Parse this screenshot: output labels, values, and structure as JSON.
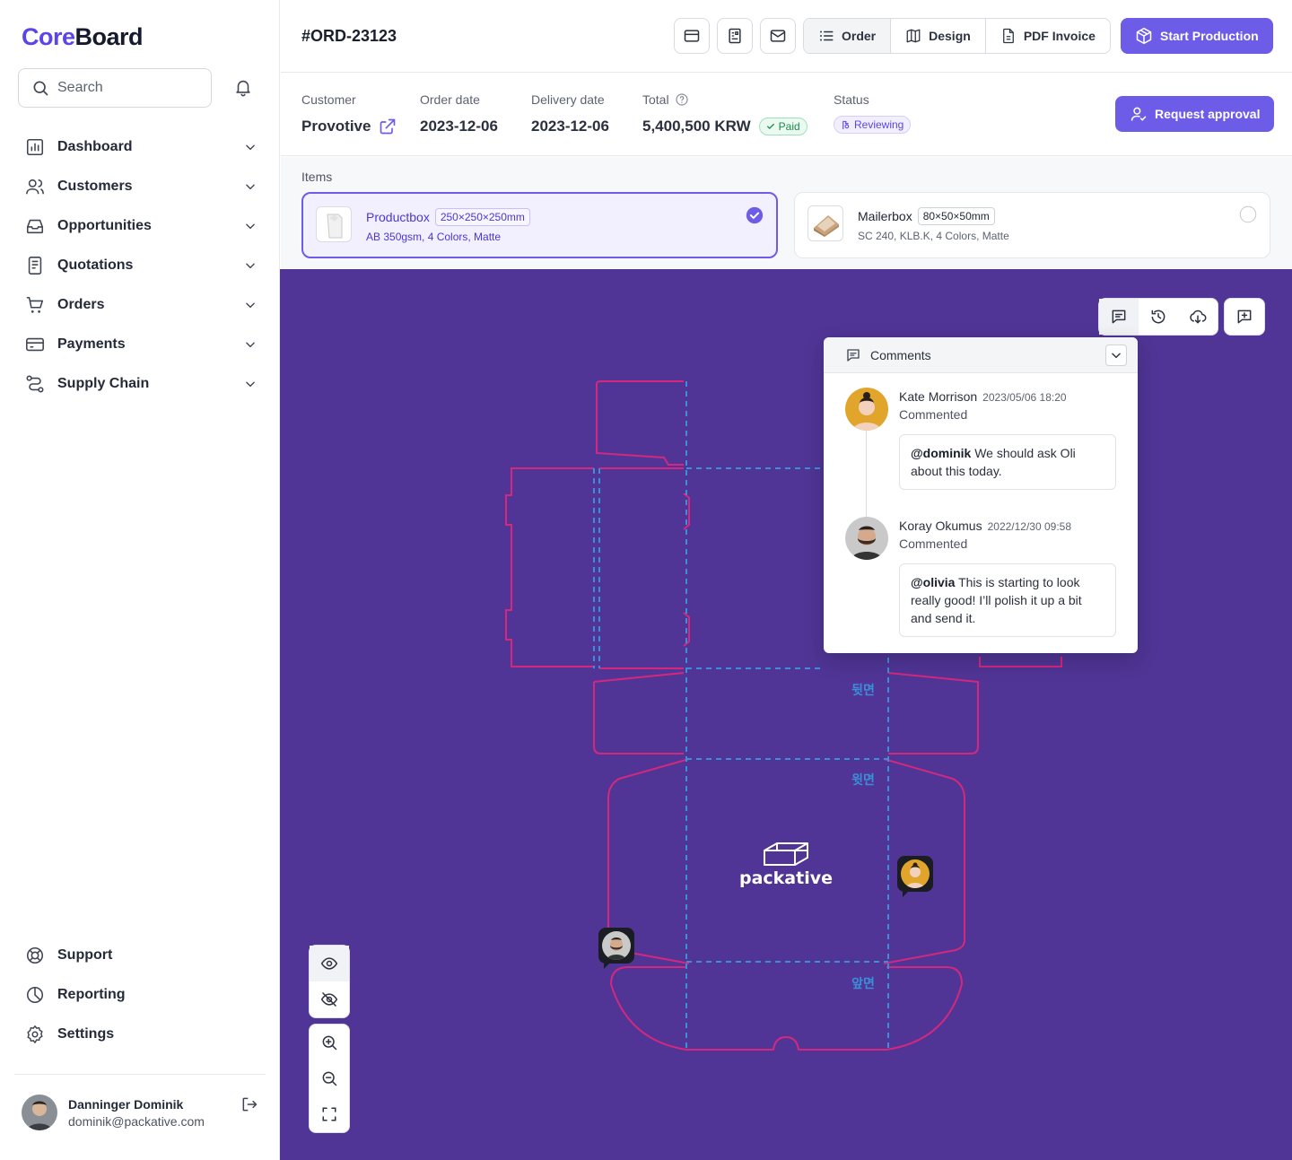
{
  "app": {
    "logo_a": "Core",
    "logo_b": "Board"
  },
  "search": {
    "placeholder": "Search"
  },
  "nav": [
    {
      "label": "Dashboard"
    },
    {
      "label": "Customers"
    },
    {
      "label": "Opportunities"
    },
    {
      "label": "Quotations"
    },
    {
      "label": "Orders"
    },
    {
      "label": "Payments"
    },
    {
      "label": "Supply Chain"
    }
  ],
  "bottom_nav": [
    {
      "label": "Support"
    },
    {
      "label": "Reporting"
    },
    {
      "label": "Settings"
    }
  ],
  "user": {
    "name": "Danninger Dominik",
    "email": "dominik@packative.com"
  },
  "header": {
    "order_id": "#ORD-23123",
    "tabs": [
      {
        "label": "Order"
      },
      {
        "label": "Design"
      },
      {
        "label": "PDF Invoice"
      }
    ],
    "start_production": "Start Production"
  },
  "order": {
    "customer_label": "Customer",
    "customer": "Provotive",
    "order_date_label": "Order date",
    "order_date": "2023-12-06",
    "delivery_date_label": "Delivery date",
    "delivery_date": "2023-12-06",
    "total_label": "Total",
    "total": "5,400,500 KRW",
    "payment_status": "Paid",
    "status_label": "Status",
    "status": "Reviewing",
    "request_approval": "Request approval"
  },
  "items": {
    "title": "Items",
    "list": [
      {
        "name": "Productbox",
        "dims": "250×250×250mm",
        "spec": "AB 350gsm, 4 Colors, Matte",
        "selected": true
      },
      {
        "name": "Mailerbox",
        "dims": "80×50×50mm",
        "spec": "SC 240, KLB.K, 4 Colors, Matte",
        "selected": false
      }
    ]
  },
  "canvas": {
    "brand_text": "packative",
    "panel_labels": [
      "뒷면",
      "윗면",
      "앞면"
    ],
    "colors": {
      "background": "#503596",
      "cut_line": "#d4287e",
      "fold_line": "#3a8fd8"
    }
  },
  "comments": {
    "title": "Comments",
    "list": [
      {
        "author": "Kate Morrison",
        "time": "2023/05/06 18:20",
        "action": "Commented",
        "mention": "@dominik",
        "text": " We should ask Oli about this today."
      },
      {
        "author": "Koray Okumus",
        "time": "2022/12/30 09:58",
        "action": "Commented",
        "mention": "@olivia",
        "text": " This is starting to look really good! I’ll polish it up a bit and send it."
      }
    ]
  },
  "theme": {
    "accent": "#6c5ce7",
    "paid": "#1f8a4b"
  }
}
